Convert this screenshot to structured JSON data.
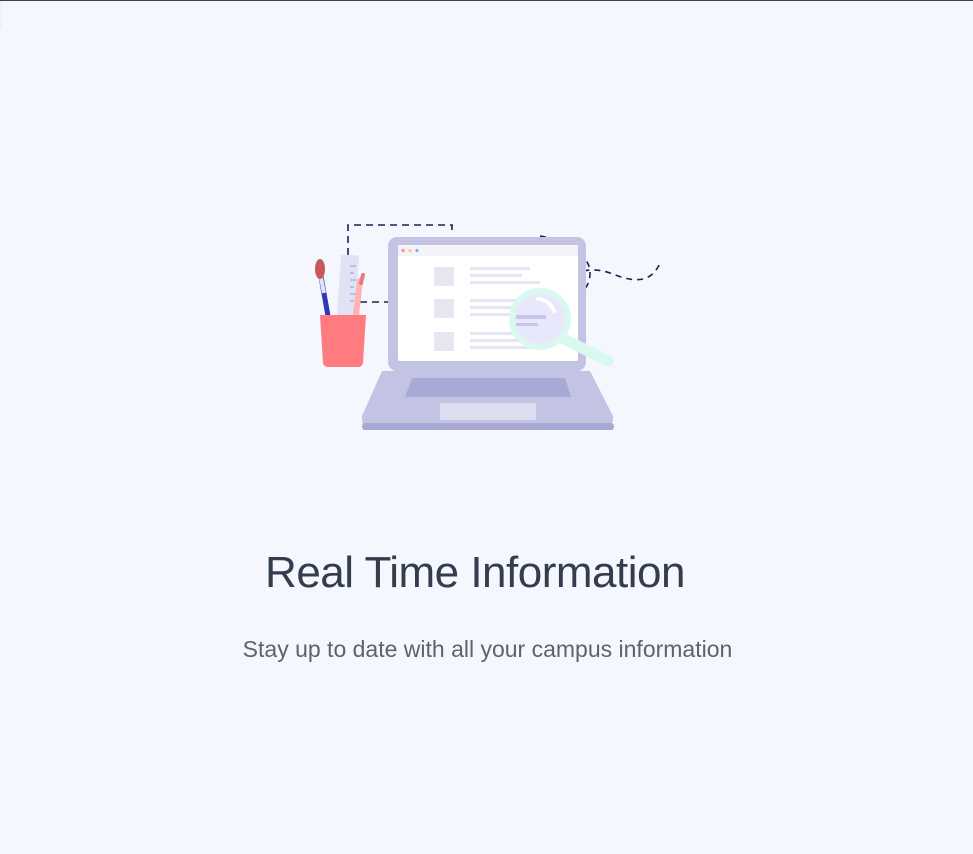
{
  "slide": {
    "title": "Real Time Information",
    "subtitle": "Stay up to date with all your campus information"
  },
  "illustration": {
    "icon": "laptop-search-illustration",
    "colors": {
      "laptop": "#c3c3e3",
      "laptop_dark": "#a9a9d6",
      "screen": "#ffffff",
      "cup": "#ff7b80",
      "magnifier": "#d8f8f0",
      "dashes": "#1f2050"
    }
  },
  "theme": {
    "background": "#f4f7fd",
    "title_color": "#343d4e",
    "subtitle_color": "#5f6368"
  }
}
